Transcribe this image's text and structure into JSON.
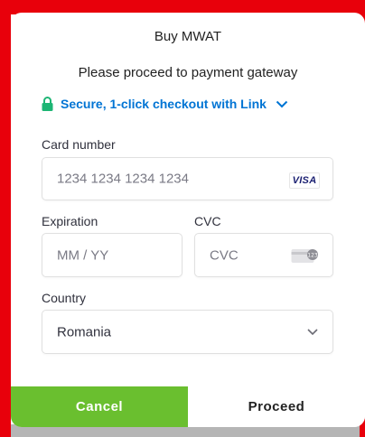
{
  "modal": {
    "title": "Buy MWAT",
    "subtitle": "Please proceed to payment gateway",
    "link_text": "Secure, 1-click checkout with Link"
  },
  "card": {
    "label": "Card number",
    "placeholder": "1234 1234 1234 1234",
    "brand": "VISA"
  },
  "expiration": {
    "label": "Expiration",
    "placeholder": "MM / YY"
  },
  "cvc": {
    "label": "CVC",
    "placeholder": "CVC"
  },
  "country": {
    "label": "Country",
    "value": "Romania"
  },
  "buttons": {
    "cancel": "Cancel",
    "proceed": "Proceed"
  },
  "colors": {
    "frame_red": "#e8000b",
    "link_blue": "#0074d4",
    "lock_green": "#1db574",
    "cancel_green": "#6abf2f"
  }
}
